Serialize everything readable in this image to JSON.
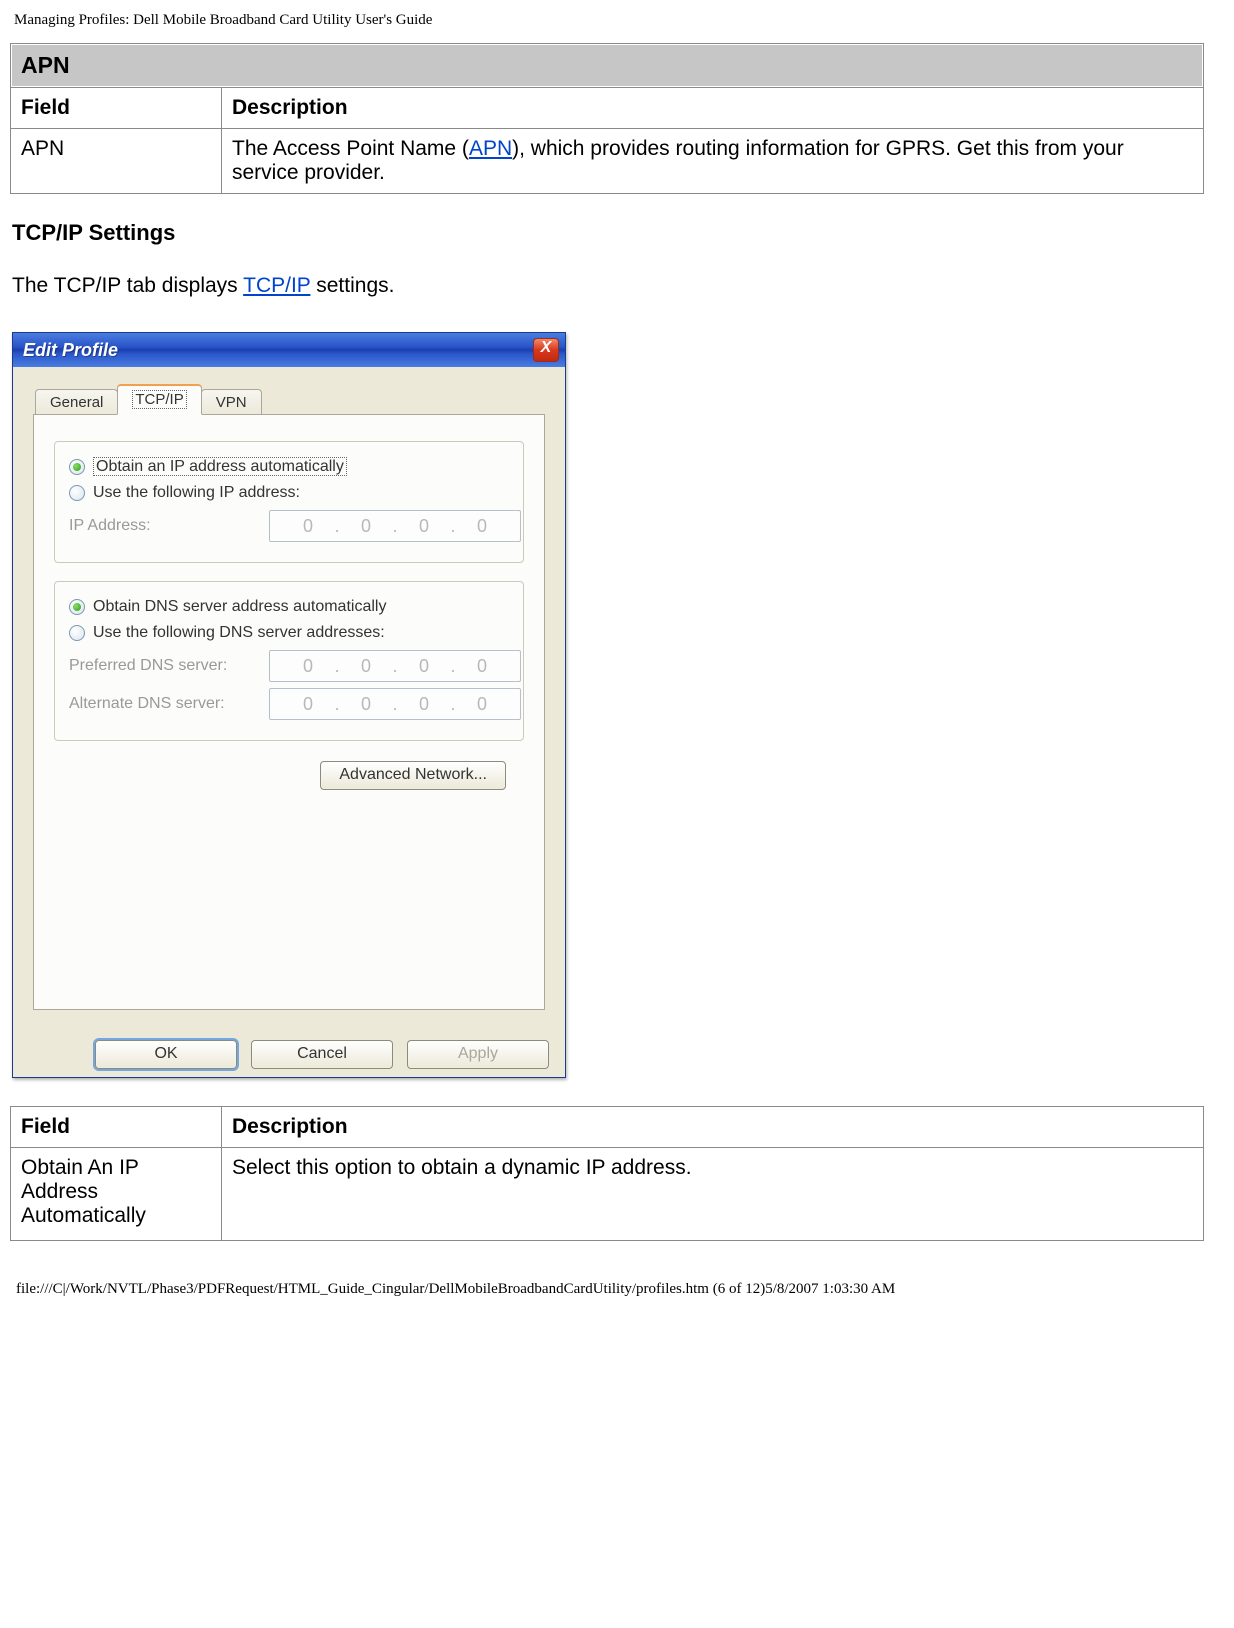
{
  "header_path": "Managing Profiles: Dell Mobile Broadband Card Utility User's Guide",
  "apn_table": {
    "section_label": "APN",
    "col_field": "Field",
    "col_desc": "Description",
    "row_field": "APN",
    "row_desc_pre": "The Access Point Name (",
    "row_desc_link": "APN",
    "row_desc_post": "), which provides routing information for GPRS. Get this from your service provider."
  },
  "tcpip_heading": "TCP/IP Settings",
  "tcpip_intro_pre": "The TCP/IP tab displays ",
  "tcpip_intro_link": "TCP/IP",
  "tcpip_intro_post": " settings.",
  "dialog": {
    "title": "Edit Profile",
    "close_glyph": "X",
    "tabs": {
      "general": "General",
      "tcpip": "TCP/IP",
      "vpn": "VPN"
    },
    "radio_obtain_ip": "Obtain an IP address automatically",
    "radio_use_ip": "Use the following IP address:",
    "ip_address_label": "IP Address:",
    "radio_obtain_dns": "Obtain DNS server address automatically",
    "radio_use_dns": "Use the following DNS server addresses:",
    "preferred_dns_label": "Preferred DNS server:",
    "alternate_dns_label": "Alternate DNS server:",
    "ip_placeholder": {
      "o1": "0",
      "o2": "0",
      "o3": "0",
      "o4": "0",
      "dot": "."
    },
    "advanced_btn": "Advanced Network...",
    "ok_btn": "OK",
    "cancel_btn": "Cancel",
    "apply_btn": "Apply"
  },
  "tcpip_table": {
    "col_field": "Field",
    "col_desc": "Description",
    "row1_field": "Obtain An IP Address Automatically",
    "row1_desc": "Select this option to obtain a dynamic IP address."
  },
  "footer_path": "file:///C|/Work/NVTL/Phase3/PDFRequest/HTML_Guide_Cingular/DellMobileBroadbandCardUtility/profiles.htm (6 of 12)5/8/2007 1:03:30 AM"
}
